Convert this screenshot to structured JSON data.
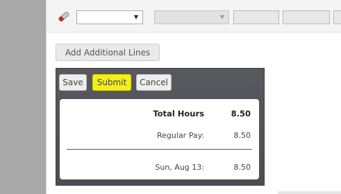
{
  "entry_row": {
    "eraser_icon": "eraser-icon",
    "dropdown_selected": "",
    "disabled_dropdown_selected": ""
  },
  "add_lines_label": "Add Additional Lines",
  "actions": {
    "save_label": "Save",
    "submit_label": "Submit",
    "cancel_label": "Cancel",
    "submit_highlight": "#f2ef1a"
  },
  "summary": {
    "total_label": "Total Hours",
    "total_value": "8.50",
    "lines": [
      {
        "label": "Regular Pay:",
        "value": "8.50"
      }
    ],
    "days": [
      {
        "label": "Sun, Aug 13:",
        "value": "8.50"
      }
    ]
  }
}
